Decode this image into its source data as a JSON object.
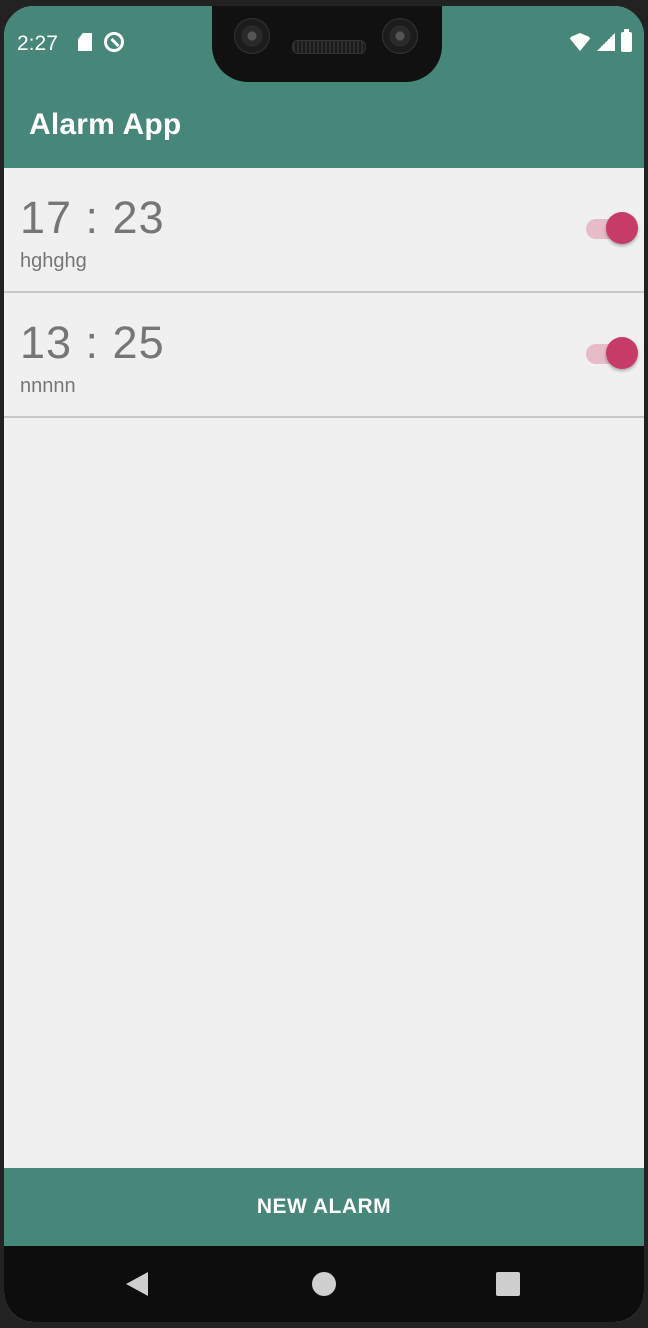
{
  "status_bar": {
    "time": "2:27",
    "left_icons": [
      "sd-card-icon",
      "sync-icon"
    ],
    "right_icons": [
      "wifi-icon",
      "signal-icon",
      "battery-icon"
    ]
  },
  "app_bar": {
    "title": "Alarm App",
    "background_color": "#468779"
  },
  "alarms": [
    {
      "time": "17 : 23",
      "label": "hghghg",
      "enabled": true
    },
    {
      "time": "13 : 25",
      "label": "nnnnn",
      "enabled": true
    }
  ],
  "footer": {
    "new_alarm_label": "NEW ALARM"
  },
  "colors": {
    "accent": "#c63b68",
    "accent_track": "#e8bbc9",
    "primary": "#468779",
    "list_background": "#f0f0f0",
    "text_secondary": "#767676"
  },
  "nav_bar": {
    "icons": [
      "back-icon",
      "home-icon",
      "recents-icon"
    ]
  }
}
